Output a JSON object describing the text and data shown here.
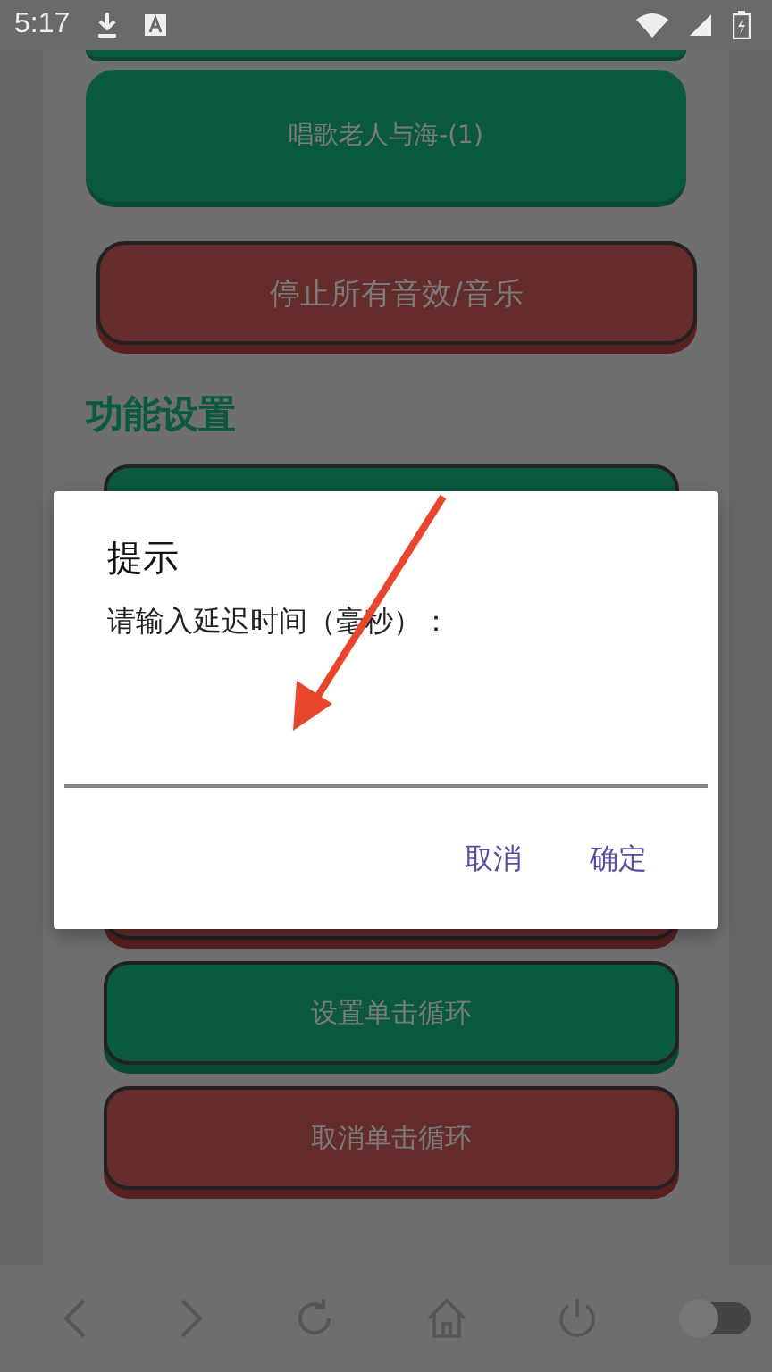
{
  "status_bar": {
    "time": "5:17"
  },
  "top_buttons": [
    {
      "kind": "start"
    },
    {
      "kind": "start",
      "label": "唱歌老人与海-(1)"
    },
    {
      "kind": "stop",
      "label": "停止所有音效/音乐"
    }
  ],
  "section_title": "功能设置",
  "bottom_buttons": [
    {
      "kind": "start"
    },
    {
      "kind": "stop"
    },
    {
      "kind": "start",
      "label": "设置单击循环"
    },
    {
      "kind": "stop",
      "label": "取消单击循环"
    }
  ],
  "dialog": {
    "title": "提示",
    "message": "请输入延迟时间（毫秒）：",
    "buttons": [
      "取消",
      "确定"
    ]
  },
  "nav_bar": {
    "toggle_on": false
  }
}
